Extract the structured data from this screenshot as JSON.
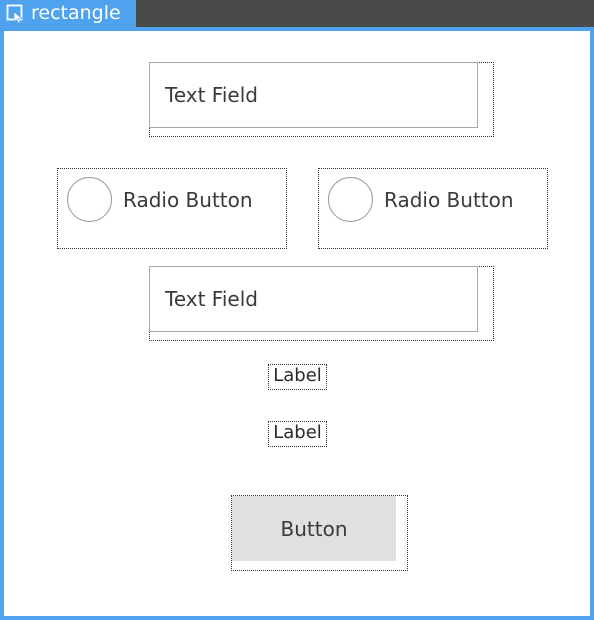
{
  "window": {
    "title": "rectangle",
    "accent_color": "#4fa3ee",
    "titlebar_color": "#4a4a4a",
    "icon": "window-select-icon"
  },
  "form": {
    "text_field_1": {
      "value": "Text Field"
    },
    "radio_1": {
      "label": "Radio Button",
      "selected": false
    },
    "radio_2": {
      "label": "Radio Button",
      "selected": false
    },
    "text_field_2": {
      "value": "Text Field"
    },
    "label_1": "Label",
    "label_2": "Label",
    "button": {
      "label": "Button"
    }
  }
}
